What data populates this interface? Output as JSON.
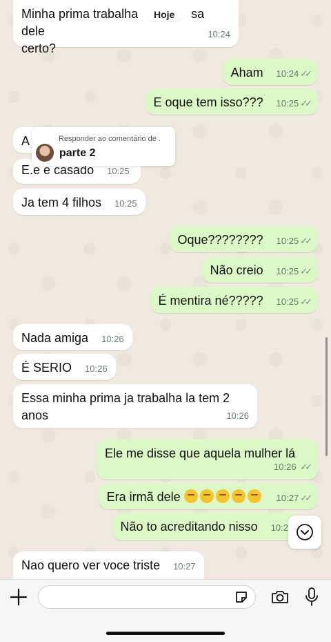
{
  "date_chip": "Hoje",
  "messages": [
    {
      "dir": "in",
      "text": "Minha prima trabalha",
      "text_cont": "sa dele",
      "line2": "certo?",
      "time": "10:24"
    },
    {
      "dir": "out",
      "text": "Aham",
      "time": "10:24"
    },
    {
      "dir": "out",
      "text": "E oque tem isso???",
      "time": "10:25"
    },
    {
      "dir": "in",
      "text": "A",
      "time": ""
    },
    {
      "dir": "in",
      "text": "E.e e casado",
      "time": "10:25"
    },
    {
      "dir": "in",
      "text": "Ja tem 4 filhos",
      "time": "10:25"
    },
    {
      "dir": "out",
      "text": "Oque????????",
      "time": "10:25"
    },
    {
      "dir": "out",
      "text": "Não creio",
      "time": "10:25"
    },
    {
      "dir": "out",
      "text": "É mentira né?????",
      "time": "10:25"
    },
    {
      "dir": "in",
      "text": "Nada amiga",
      "time": "10:26"
    },
    {
      "dir": "in",
      "text": "É SERIO",
      "time": "10:26"
    },
    {
      "dir": "in",
      "text": "Essa minha prima ja trabalha la tem 2",
      "line2": "anos",
      "time": "10:26"
    },
    {
      "dir": "out",
      "text": "Ele me disse que aquela mulher lá",
      "time": "10:26"
    },
    {
      "dir": "out",
      "text": "Era irmã dele",
      "time": "10:27"
    },
    {
      "dir": "out",
      "text": "Não to acreditando nisso",
      "time": "10:2"
    },
    {
      "dir": "in",
      "text": "Nao quero ver voce triste",
      "time": "10:27"
    }
  ],
  "reply_card": {
    "header": "Responder ao comentário de .",
    "title": "parte 2"
  },
  "icons": {
    "plus": "plus-icon",
    "sticker": "sticker-icon",
    "camera": "camera-icon",
    "mic": "microphone-icon",
    "scroll": "chevron-down-icon",
    "check": "double-check-icon"
  },
  "colors": {
    "outgoing": "#dcf8c6",
    "incoming": "#ffffff",
    "background": "#efe9df"
  }
}
